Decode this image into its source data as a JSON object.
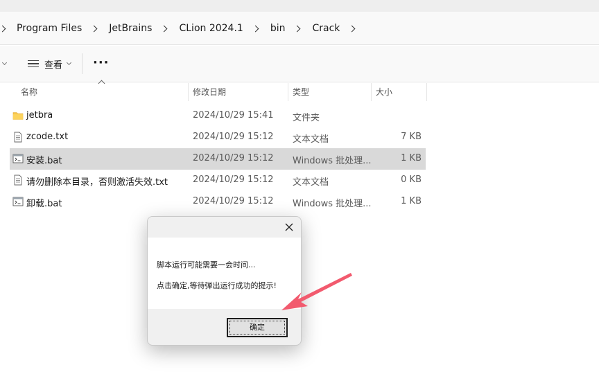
{
  "breadcrumb": [
    "Program Files",
    "JetBrains",
    "CLion 2024.1",
    "bin",
    "Crack"
  ],
  "toolbar": {
    "view_label": "查看",
    "more_label": "···"
  },
  "columns": {
    "name": "名称",
    "date": "修改日期",
    "type": "类型",
    "size": "大小"
  },
  "files": [
    {
      "icon": "folder-icon",
      "name": "jetbra",
      "date": "2024/10/29 15:41",
      "type": "文件夹",
      "size": ""
    },
    {
      "icon": "text-file-icon",
      "name": "zcode.txt",
      "date": "2024/10/29 15:12",
      "type": "文本文档",
      "size": "7 KB"
    },
    {
      "icon": "batch-file-icon",
      "name": "安装.bat",
      "date": "2024/10/29 15:12",
      "type": "Windows 批处理...",
      "size": "1 KB"
    },
    {
      "icon": "text-file-icon",
      "name": "请勿删除本目录，否则激活失效.txt",
      "date": "2024/10/29 15:12",
      "type": "文本文档",
      "size": "0 KB"
    },
    {
      "icon": "batch-file-icon",
      "name": "卸载.bat",
      "date": "2024/10/29 15:12",
      "type": "Windows 批处理...",
      "size": "1 KB"
    }
  ],
  "selected_file_index": 2,
  "dialog": {
    "line1": "脚本运行可能需要一会时间...",
    "line2": "点击确定,等待弹出运行成功的提示!",
    "ok_label": "确定"
  },
  "colors": {
    "annotation_arrow": "#f25a6e",
    "selected_row": "#d9d9d9",
    "folder": "#f8c64b"
  }
}
